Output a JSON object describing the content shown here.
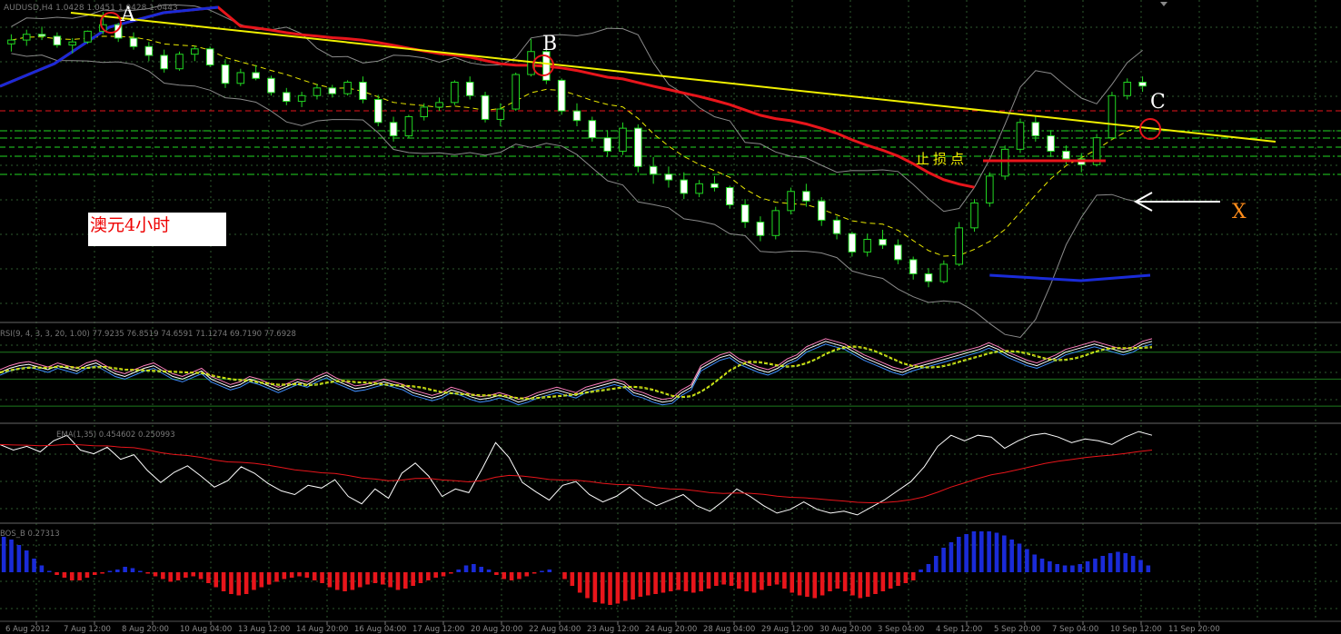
{
  "chart_data": [
    {
      "panel": "price",
      "type": "candlestick",
      "symbol_info": "AUDUSD,H4  1.0428 1.0451 1.0428 1.0443",
      "annotation_text": "澳元4小时",
      "stop_loss_label": "止损点",
      "point_labels": [
        "A",
        "B",
        "C",
        "X"
      ],
      "ohlc_h4": [
        [
          1.0415,
          1.044,
          1.0395,
          1.0425
        ],
        [
          1.0425,
          1.0452,
          1.041,
          1.044
        ],
        [
          1.044,
          1.046,
          1.0425,
          1.0435
        ],
        [
          1.0435,
          1.0445,
          1.0405,
          1.0412
        ],
        [
          1.0412,
          1.043,
          1.039,
          1.042
        ],
        [
          1.042,
          1.045,
          1.0415,
          1.0448
        ],
        [
          1.0448,
          1.0498,
          1.044,
          1.0465
        ],
        [
          1.0465,
          1.047,
          1.042,
          1.043
        ],
        [
          1.043,
          1.0445,
          1.04,
          1.0408
        ],
        [
          1.0408,
          1.042,
          1.037,
          1.0385
        ],
        [
          1.0385,
          1.04,
          1.034,
          1.035
        ],
        [
          1.035,
          1.0395,
          1.0345,
          1.0388
        ],
        [
          1.0388,
          1.041,
          1.037,
          1.0402
        ],
        [
          1.0402,
          1.0408,
          1.0355,
          1.036
        ],
        [
          1.036,
          1.0375,
          1.03,
          1.0312
        ],
        [
          1.0312,
          1.035,
          1.0305,
          1.034
        ],
        [
          1.034,
          1.036,
          1.032,
          1.0325
        ],
        [
          1.0325,
          1.0332,
          1.028,
          1.0288
        ],
        [
          1.0288,
          1.03,
          1.0255,
          1.0265
        ],
        [
          1.0265,
          1.029,
          1.025,
          1.028
        ],
        [
          1.028,
          1.031,
          1.027,
          1.03
        ],
        [
          1.03,
          1.0308,
          1.0275,
          1.0285
        ],
        [
          1.0285,
          1.032,
          1.028,
          1.0315
        ],
        [
          1.0315,
          1.033,
          1.026,
          1.027
        ],
        [
          1.027,
          1.0282,
          1.02,
          1.021
        ],
        [
          1.021,
          1.0225,
          1.016,
          1.0175
        ],
        [
          1.0175,
          1.023,
          1.017,
          1.0225
        ],
        [
          1.0225,
          1.026,
          1.0215,
          1.025
        ],
        [
          1.025,
          1.0275,
          1.024,
          1.0262
        ],
        [
          1.0262,
          1.032,
          1.0255,
          1.0315
        ],
        [
          1.0315,
          1.033,
          1.027,
          1.028
        ],
        [
          1.028,
          1.029,
          1.021,
          1.0218
        ],
        [
          1.0218,
          1.026,
          1.02,
          1.0245
        ],
        [
          1.0245,
          1.034,
          1.024,
          1.0335
        ],
        [
          1.0335,
          1.0428,
          1.033,
          1.0395
        ],
        [
          1.0395,
          1.041,
          1.031,
          1.032
        ],
        [
          1.032,
          1.0325,
          1.023,
          1.024
        ],
        [
          1.024,
          1.026,
          1.02,
          1.0215
        ],
        [
          1.0215,
          1.0225,
          1.016,
          1.017
        ],
        [
          1.017,
          1.019,
          1.012,
          1.0135
        ],
        [
          1.0135,
          1.021,
          1.0125,
          1.0195
        ],
        [
          1.0195,
          1.0205,
          1.008,
          1.0095
        ],
        [
          1.0095,
          1.012,
          1.005,
          1.0075
        ],
        [
          1.0075,
          1.0095,
          1.004,
          1.006
        ],
        [
          1.006,
          1.008,
          1.001,
          1.0025
        ],
        [
          1.0025,
          1.006,
          1.0015,
          1.005
        ],
        [
          1.005,
          1.007,
          1.003,
          1.004
        ],
        [
          1.004,
          1.0045,
          0.9985,
          0.9995
        ],
        [
          0.9995,
          1.001,
          0.9935,
          0.995
        ],
        [
          0.995,
          0.9965,
          0.99,
          0.9915
        ],
        [
          0.9915,
          0.999,
          0.9905,
          0.998
        ],
        [
          0.998,
          1.004,
          0.997,
          1.003
        ],
        [
          1.003,
          1.005,
          0.999,
          1.0005
        ],
        [
          1.0005,
          1.0015,
          0.994,
          0.9955
        ],
        [
          0.9955,
          0.9965,
          0.9905,
          0.992
        ],
        [
          0.992,
          0.9925,
          0.986,
          0.9872
        ],
        [
          0.9872,
          0.992,
          0.986,
          0.9905
        ],
        [
          0.9905,
          0.993,
          0.988,
          0.989
        ],
        [
          0.989,
          0.9905,
          0.984,
          0.9852
        ],
        [
          0.9852,
          0.986,
          0.98,
          0.9815
        ],
        [
          0.9815,
          0.983,
          0.978,
          0.9795
        ],
        [
          0.9795,
          0.985,
          0.979,
          0.984
        ],
        [
          0.984,
          0.995,
          0.9835,
          0.9935
        ],
        [
          0.9935,
          1.001,
          0.9925,
          1.0
        ],
        [
          1.0,
          1.008,
          0.999,
          1.007
        ],
        [
          1.007,
          1.015,
          1.006,
          1.014
        ],
        [
          1.014,
          1.022,
          1.013,
          1.021
        ],
        [
          1.021,
          1.0225,
          1.016,
          1.0175
        ],
        [
          1.0175,
          1.019,
          1.012,
          1.0135
        ],
        [
          1.0135,
          1.015,
          1.01,
          1.0115
        ],
        [
          1.0115,
          1.013,
          1.008,
          1.01
        ],
        [
          1.01,
          1.018,
          1.0095,
          1.017
        ],
        [
          1.017,
          1.029,
          1.0165,
          1.028
        ],
        [
          1.028,
          1.0325,
          1.027,
          1.0315
        ],
        [
          1.0315,
          1.033,
          1.029,
          1.0305
        ]
      ],
      "bollinger_ma_period": 20,
      "slow_ma_color": "#e8151b",
      "slow_ma_tail_color": "#1a2bd8",
      "trendline_color": "#f0f000",
      "candle_color": "#22d822",
      "grid_color": "#2e5a2e"
    },
    {
      "panel": "RSI",
      "type": "line",
      "header": "RSI(9, 4, 3, 3, 20, 1.00) 77.9235 76.8519 74.6591 71.1274 69.7190 77.6928",
      "levels": [
        30,
        50,
        70
      ],
      "series_colors": [
        "#ffffff",
        "#3f8fff",
        "#ff7fbf",
        "#c8ff32",
        "#e8e800"
      ],
      "rsi_values": [
        55,
        58,
        60,
        61,
        59,
        57,
        60,
        58,
        56,
        60,
        62,
        58,
        54,
        52,
        55,
        58,
        60,
        56,
        52,
        50,
        53,
        56,
        50,
        47,
        44,
        46,
        50,
        48,
        45,
        42,
        45,
        48,
        46,
        50,
        53,
        49,
        46,
        43,
        44,
        46,
        48,
        46,
        44,
        40,
        38,
        36,
        38,
        42,
        40,
        37,
        35,
        36,
        38,
        36,
        33,
        35,
        38,
        40,
        42,
        40,
        38,
        42,
        44,
        46,
        48,
        46,
        40,
        38,
        35,
        33,
        34,
        40,
        44,
        58,
        62,
        66,
        68,
        63,
        60,
        57,
        55,
        58,
        63,
        66,
        72,
        75,
        78,
        76,
        74,
        70,
        66,
        63,
        60,
        57,
        55,
        58,
        60,
        62,
        64,
        66,
        68,
        70,
        72,
        75,
        72,
        68,
        65,
        62,
        60,
        63,
        66,
        70,
        72,
        74,
        76,
        74,
        72,
        70,
        72,
        76,
        78
      ]
    },
    {
      "panel": "oscillator",
      "type": "line",
      "header": "EMA(1,35) 0.454602 0.250993",
      "series_colors": [
        "#ffffff",
        "#e8151b"
      ],
      "osc_values": [
        0.36,
        0.3,
        0.34,
        0.28,
        0.4,
        0.46,
        0.3,
        0.26,
        0.33,
        0.2,
        0.25,
        0.08,
        -0.05,
        0.06,
        0.13,
        0.02,
        -0.1,
        -0.03,
        0.12,
        0.05,
        -0.06,
        -0.14,
        -0.18,
        -0.08,
        -0.11,
        -0.02,
        -0.2,
        -0.28,
        -0.12,
        -0.22,
        0.05,
        0.16,
        0.02,
        -0.2,
        -0.12,
        -0.16,
        0.1,
        0.38,
        0.22,
        -0.05,
        -0.15,
        -0.24,
        -0.08,
        -0.04,
        -0.18,
        -0.26,
        -0.2,
        -0.1,
        -0.22,
        -0.3,
        -0.24,
        -0.18,
        -0.3,
        -0.36,
        -0.25,
        -0.12,
        -0.2,
        -0.3,
        -0.38,
        -0.34,
        -0.26,
        -0.34,
        -0.38,
        -0.36,
        -0.4,
        -0.32,
        -0.24,
        -0.14,
        -0.04,
        0.12,
        0.34,
        0.46,
        0.4,
        0.46,
        0.44,
        0.32,
        0.4,
        0.46,
        0.48,
        0.44,
        0.38,
        0.42,
        0.4,
        0.36,
        0.44,
        0.5,
        0.46
      ]
    },
    {
      "panel": "histogram",
      "type": "bar",
      "header": "BOS_B 0.27313",
      "positive_color": "#1a2bd8",
      "negative_color": "#e8151b",
      "hist_values": [
        0.26,
        0.24,
        0.2,
        0.16,
        0.1,
        0.05,
        0.01,
        -0.02,
        -0.04,
        -0.06,
        -0.06,
        -0.04,
        -0.02,
        -0.01,
        0.01,
        0.02,
        0.04,
        0.03,
        0.01,
        -0.01,
        -0.03,
        -0.05,
        -0.07,
        -0.06,
        -0.04,
        -0.03,
        -0.05,
        -0.08,
        -0.11,
        -0.14,
        -0.16,
        -0.17,
        -0.16,
        -0.13,
        -0.11,
        -0.09,
        -0.07,
        -0.05,
        -0.04,
        -0.03,
        -0.04,
        -0.06,
        -0.08,
        -0.11,
        -0.13,
        -0.14,
        -0.13,
        -0.11,
        -0.09,
        -0.08,
        -0.09,
        -0.11,
        -0.13,
        -0.12,
        -0.1,
        -0.08,
        -0.06,
        -0.04,
        -0.03,
        -0.01,
        0.02,
        0.05,
        0.06,
        0.04,
        0.02,
        -0.02,
        -0.05,
        -0.06,
        -0.05,
        -0.03,
        -0.01,
        0.01,
        0.02,
        0.0,
        -0.05,
        -0.1,
        -0.15,
        -0.19,
        -0.22,
        -0.23,
        -0.24,
        -0.23,
        -0.21,
        -0.2,
        -0.18,
        -0.17,
        -0.16,
        -0.15,
        -0.14,
        -0.13,
        -0.14,
        -0.15,
        -0.14,
        -0.12,
        -0.1,
        -0.09,
        -0.1,
        -0.12,
        -0.14,
        -0.15,
        -0.13,
        -0.1,
        -0.09,
        -0.12,
        -0.15,
        -0.17,
        -0.18,
        -0.19,
        -0.17,
        -0.14,
        -0.12,
        -0.14,
        -0.17,
        -0.19,
        -0.18,
        -0.16,
        -0.14,
        -0.12,
        -0.1,
        -0.08,
        -0.06,
        0.02,
        0.06,
        0.12,
        0.18,
        0.22,
        0.26,
        0.28,
        0.3,
        0.3,
        0.3,
        0.29,
        0.27,
        0.24,
        0.21,
        0.17,
        0.13,
        0.1,
        0.08,
        0.06,
        0.05,
        0.05,
        0.06,
        0.08,
        0.1,
        0.12,
        0.14,
        0.15,
        0.14,
        0.12,
        0.09,
        0.05
      ],
      "time_labels": [
        "6 Aug 2012",
        "7 Aug 12:00",
        "8 Aug 20:00",
        "10 Aug 04:00",
        "13 Aug 12:00",
        "14 Aug 20:00",
        "16 Aug 04:00",
        "17 Aug 12:00",
        "20 Aug 20:00",
        "22 Aug 04:00",
        "23 Aug 12:00",
        "24 Aug 20:00",
        "28 Aug 04:00",
        "29 Aug 12:00",
        "30 Aug 20:00",
        "3 Sep 04:00",
        "4 Sep 12:00",
        "5 Sep 20:00",
        "7 Sep 04:00",
        "10 Sep 12:00",
        "11 Sep 20:00"
      ]
    }
  ]
}
